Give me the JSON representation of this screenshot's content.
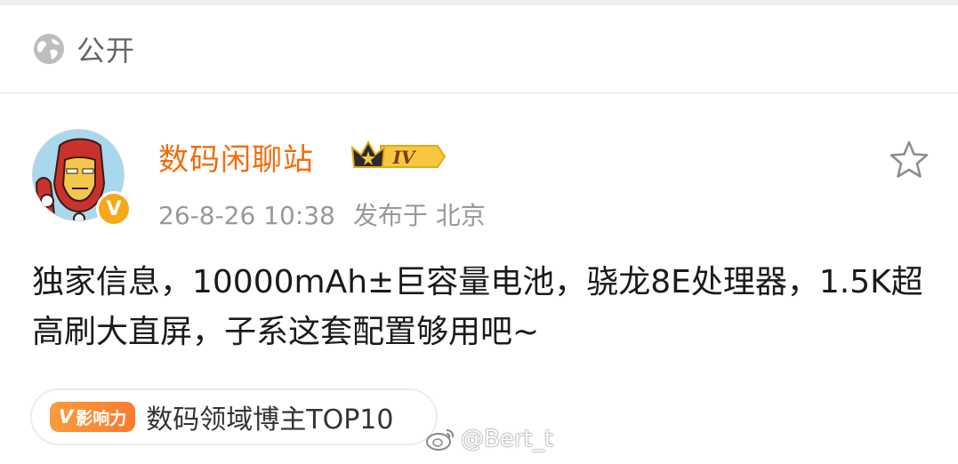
{
  "visibility": {
    "label": "公开",
    "icon": "globe-icon"
  },
  "post": {
    "author": "数码闲聊站",
    "level_badge": "IV",
    "verified_badge": "V",
    "timestamp": "26-8-26 10:38",
    "source": "发布于 北京",
    "content": "独家信息，10000mAh±巨容量电池，骁龙8E处理器，1.5K超高刷大直屏，子系这套配置够用吧~",
    "tag_pill": {
      "v": "V",
      "text": "影响力"
    },
    "tag_text": "数码领域博主TOP10"
  },
  "watermark": "@Bert_t",
  "colors": {
    "author": "#f56b0b",
    "meta": "#999999",
    "badge": "#f7a818"
  }
}
